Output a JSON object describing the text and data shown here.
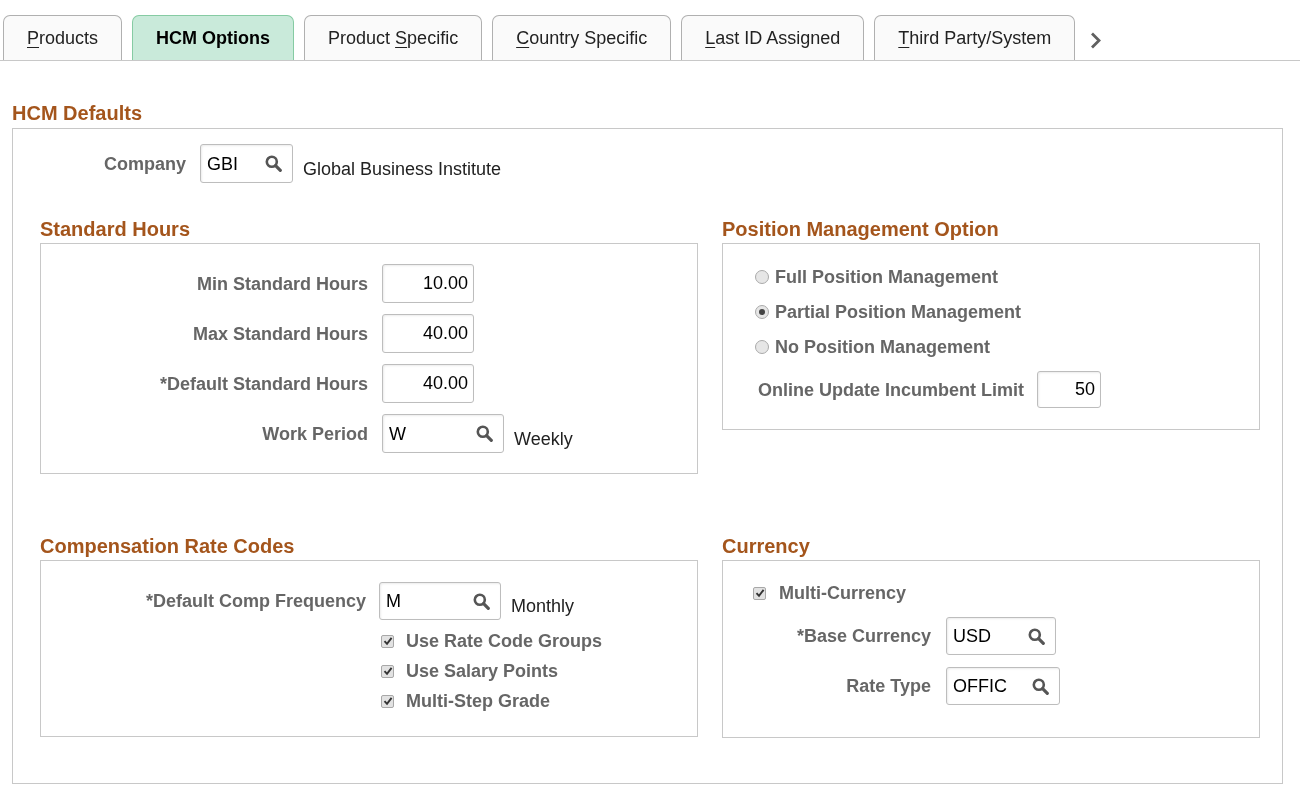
{
  "tabs": [
    {
      "access_key": "P",
      "text_after": "roducts",
      "selected": false
    },
    {
      "text_before": "HCM Options",
      "selected": true
    },
    {
      "text_before": "Product ",
      "access_key": "S",
      "text_after": "pecific",
      "selected": false
    },
    {
      "access_key": "C",
      "text_after": "ountry Specific",
      "selected": false
    },
    {
      "access_key": "L",
      "text_after": "ast ID Assigned",
      "selected": false
    },
    {
      "access_key": "T",
      "text_after": "hird Party/System",
      "selected": false
    }
  ],
  "hcm_defaults": {
    "title": "HCM Defaults",
    "company": {
      "label": "Company",
      "value": "GBI",
      "description": "Global Business Institute"
    },
    "standard_hours": {
      "title": "Standard Hours",
      "fields": [
        {
          "kind": "number",
          "label": "Min Standard Hours",
          "value": "10.00"
        },
        {
          "kind": "number",
          "label": "Max Standard Hours",
          "value": "40.00"
        },
        {
          "kind": "number",
          "label": "*Default Standard Hours",
          "value": "40.00"
        },
        {
          "kind": "lookup",
          "label": "Work Period",
          "value": "W",
          "description": "Weekly"
        }
      ]
    },
    "position_management_option": {
      "title": "Position Management Option",
      "options": [
        {
          "label": "Full Position Management",
          "selected": false
        },
        {
          "label": "Partial Position Management",
          "selected": true
        },
        {
          "label": "No Position Management",
          "selected": false
        }
      ],
      "incumbent_limit": {
        "kind": "number",
        "label": "Online Update Incumbent Limit",
        "value": "50"
      }
    },
    "compensation_rate_codes": {
      "title": "Compensation Rate Codes",
      "fields": [
        {
          "kind": "lookup",
          "label": "*Default Comp Frequency",
          "value": "M",
          "description": "Monthly"
        }
      ],
      "checkboxes": [
        {
          "label": "Use Rate Code Groups",
          "checked": true
        },
        {
          "label": "Use Salary Points",
          "checked": true
        },
        {
          "label": "Multi-Step Grade",
          "checked": true
        }
      ]
    },
    "currency": {
      "title": "Currency",
      "multi_currency": {
        "label": "Multi-Currency",
        "checked": true
      },
      "fields": [
        {
          "kind": "lookup",
          "label": "*Base Currency",
          "value": "USD"
        },
        {
          "kind": "lookup",
          "label": "Rate Type",
          "value": "OFFIC"
        }
      ]
    }
  }
}
